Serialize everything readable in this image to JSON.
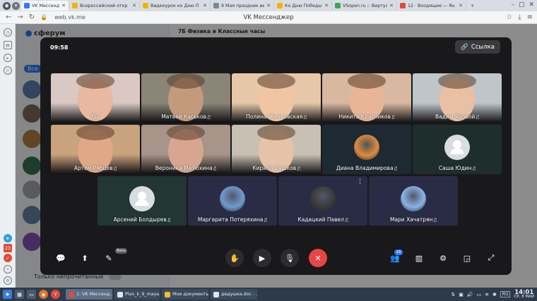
{
  "browser": {
    "tabs": [
      {
        "label": "VK Мессендж",
        "icon_color": "#2f7bf5",
        "active": true
      },
      {
        "label": "Всероссийский откр",
        "icon_color": "#f0b400",
        "active": false
      },
      {
        "label": "Видеоурок ко Дню П",
        "icon_color": "#f0b400",
        "active": false
      },
      {
        "label": "9 Мая праздник вел",
        "icon_color": "#7b8794",
        "active": false
      },
      {
        "label": "Ко Дню Победы. Ви",
        "icon_color": "#f0b400",
        "active": false
      },
      {
        "label": "VSopen.ru :: Виртуа",
        "icon_color": "#3aa655",
        "active": false
      },
      {
        "label": "12 · Входящие — Ян",
        "icon_color": "#e04a3a",
        "active": false
      }
    ],
    "new_tab": "+",
    "url": "web.vk.me",
    "page_title": "VK Мессенджер"
  },
  "vk": {
    "logo": "сферум",
    "filter_all": "Все",
    "chat_title": "7Б Физика и Классные часы",
    "only_unread": "Только непрочитанные"
  },
  "call": {
    "timer": "09:58",
    "link_label": "Ссылка",
    "participants": [
      {
        "name": "Вы",
        "muted": false,
        "kind": "video",
        "bg": "#d9c8c4",
        "face": "#e8b9a0"
      },
      {
        "name": "Матвей Каськов",
        "muted": true,
        "kind": "video",
        "bg": "#8a8576",
        "face": "#c49a7c"
      },
      {
        "name": "Полина Жечковская",
        "muted": true,
        "kind": "video",
        "bg": "#e6c8a8",
        "face": "#f0c6a2"
      },
      {
        "name": "Никита Красников",
        "muted": true,
        "kind": "video",
        "bg": "#d8b8a0",
        "face": "#e8b696"
      },
      {
        "name": "Вадим Яровой",
        "muted": true,
        "kind": "video",
        "bg": "#bfc5c8",
        "face": "#e8c0a4"
      },
      {
        "name": "Артём Рябцев",
        "muted": true,
        "kind": "video",
        "bg": "#c9a27e",
        "face": "#e0a886"
      },
      {
        "name": "Вероника Матюхина",
        "muted": true,
        "kind": "video",
        "bg": "#a89488",
        "face": "#d8a690"
      },
      {
        "name": "Кирилл Сушков",
        "muted": true,
        "kind": "video",
        "bg": "#c9c0b4",
        "face": "#e6c2a8"
      },
      {
        "name": "Диана Владимирова",
        "muted": true,
        "kind": "photo",
        "bg": "#1d2a33",
        "photo": "#e08a3c"
      },
      {
        "name": "Саша Юдин",
        "muted": true,
        "kind": "placeholder",
        "bg": "#1e2e2c"
      },
      {
        "name": "Арсений Болдырев",
        "muted": true,
        "kind": "placeholder",
        "bg": "#223634"
      },
      {
        "name": "Маргарита Потеряхина",
        "muted": true,
        "kind": "photo",
        "bg": "#2a2c46",
        "photo": "#6f9bd0"
      },
      {
        "name": "Кадацкий Павел",
        "muted": true,
        "kind": "photo",
        "bg": "#2a2c46",
        "photo": "#3a3a3a"
      },
      {
        "name": "Мари Хачатрян",
        "muted": true,
        "kind": "photo",
        "bg": "#2a2c46",
        "photo": "#88b4e6"
      }
    ],
    "controls": {
      "participants_count": "16",
      "draw_badge": "Beta"
    }
  },
  "taskbar": {
    "tasks": [
      {
        "label": "1: VK Мессенд...",
        "icon_color": "#e04a3a",
        "active": true
      },
      {
        "label": "Plan_k_9_maya...",
        "icon_color": "#dfe6ee",
        "active": false
      },
      {
        "label": "Мои документы...",
        "icon_color": "#f0c030",
        "active": false
      },
      {
        "label": "дедушка.doc - ...",
        "icon_color": "#dfe6ee",
        "active": false
      }
    ],
    "lang": "RU",
    "time": "14:01",
    "date": "СР, 8 МАЙ"
  },
  "colors": {
    "accent": "#2f7bf5",
    "end_call": "#e64646",
    "call_bg": "#19191b"
  }
}
